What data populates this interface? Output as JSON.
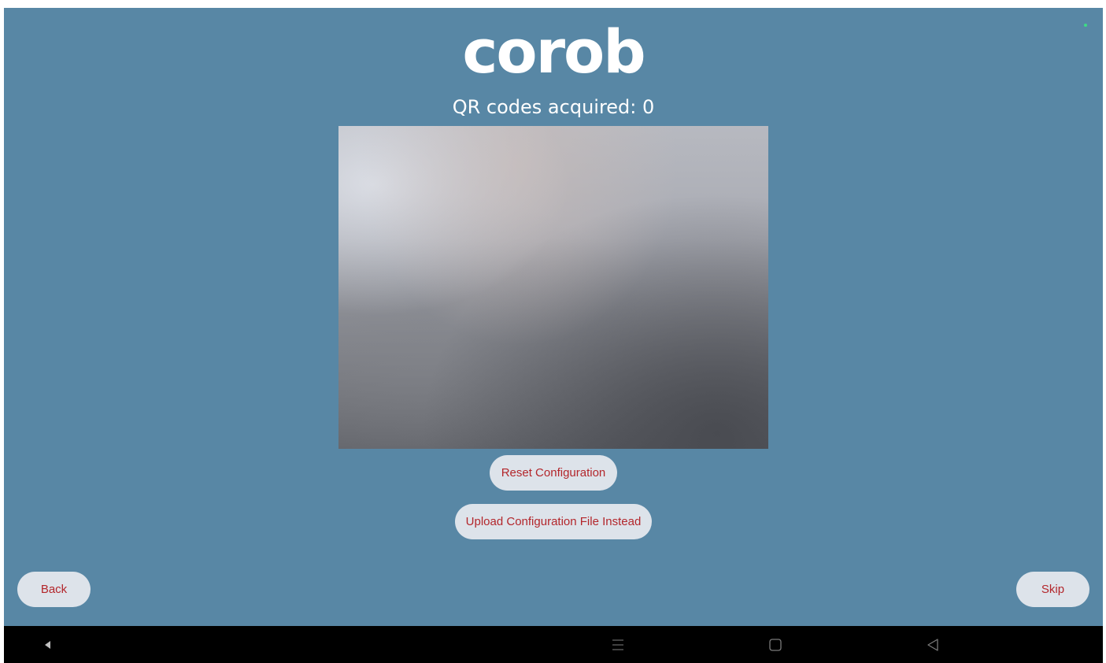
{
  "app": {
    "logo_text": "corob",
    "qr_status": "QR codes acquired: 0"
  },
  "buttons": {
    "reset": "Reset Configuration",
    "upload": "Upload Configuration File Instead",
    "back": "Back",
    "skip": "Skip"
  },
  "colors": {
    "background": "#5887a5",
    "button_bg": "#dde3ea",
    "button_text": "#b3262b",
    "status_dot": "#3ddc84",
    "navbar": "#000000"
  },
  "navbar": {
    "icons": [
      "triangle-left-icon",
      "menu-lines-icon",
      "square-home-icon",
      "triangle-back-icon"
    ]
  }
}
